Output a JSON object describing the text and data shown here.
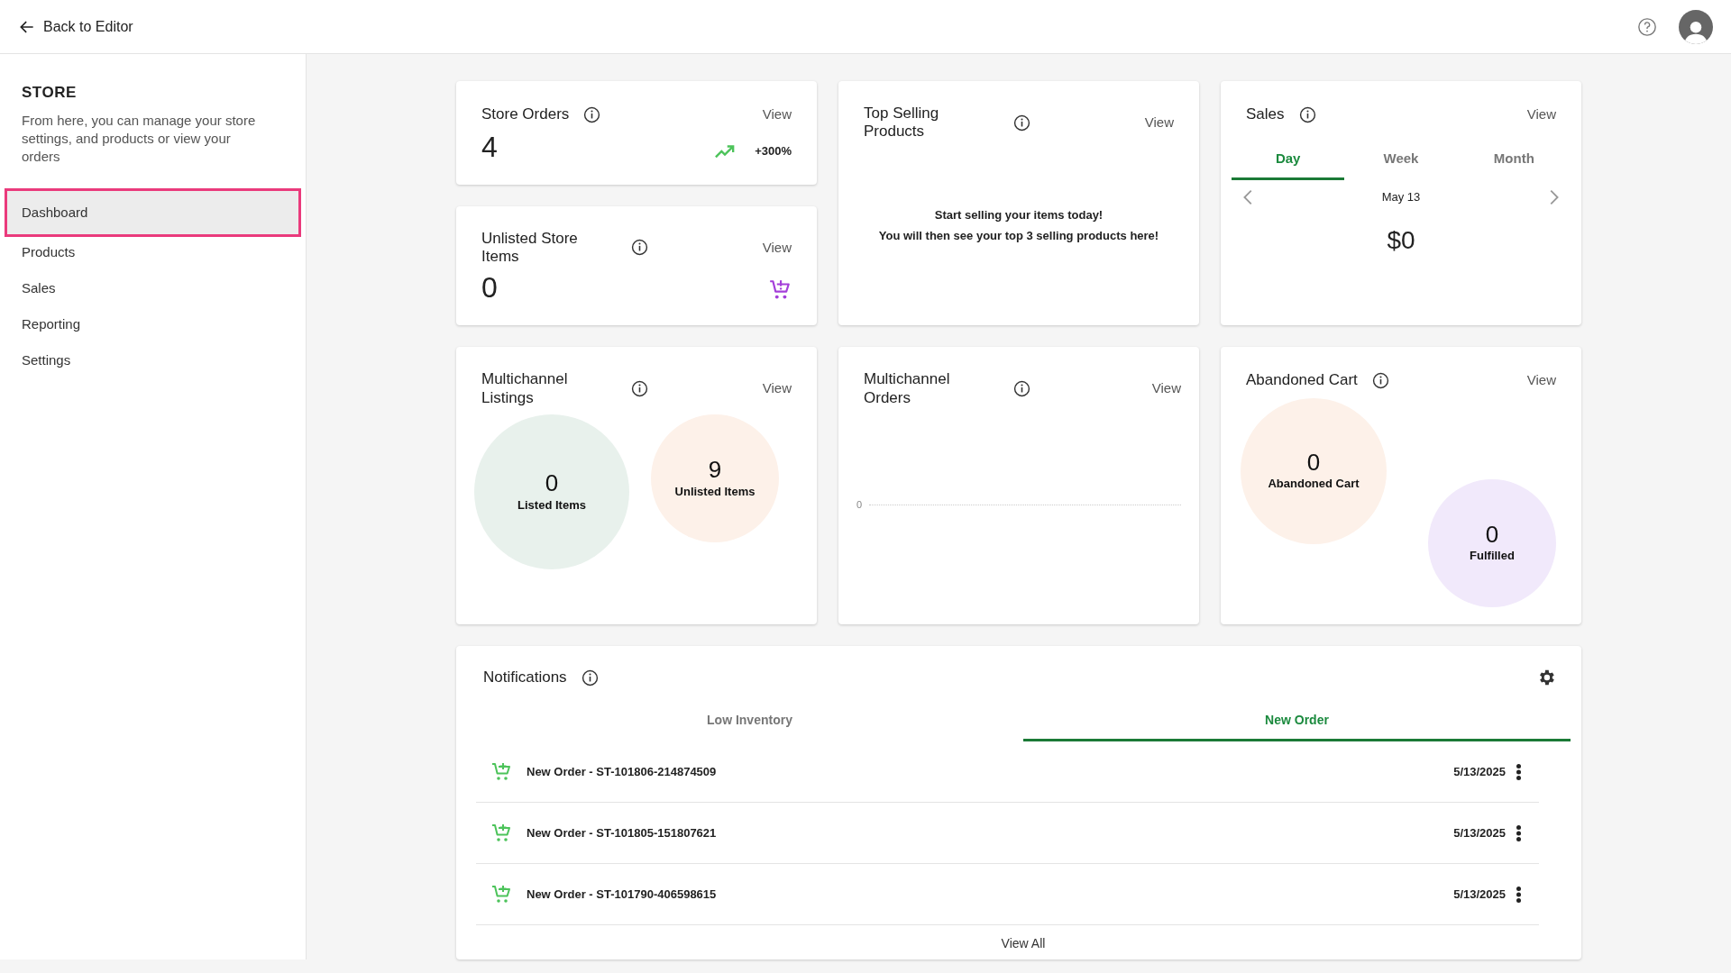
{
  "header": {
    "back_label": "Back to Editor"
  },
  "sidebar": {
    "title": "STORE",
    "description": "From here, you can manage your store settings, and products or view your orders",
    "items": [
      {
        "label": "Dashboard",
        "selected": true
      },
      {
        "label": "Products",
        "selected": false
      },
      {
        "label": "Sales",
        "selected": false
      },
      {
        "label": "Reporting",
        "selected": false
      },
      {
        "label": "Settings",
        "selected": false
      }
    ]
  },
  "store_orders": {
    "title": "Store Orders",
    "view": "View",
    "value": "4",
    "change": "+300%"
  },
  "unlisted_items": {
    "title": "Unlisted Store Items",
    "view": "View",
    "value": "0"
  },
  "top_selling": {
    "title": "Top Selling Products",
    "view": "View",
    "message_lines": [
      "Start selling your items today!",
      "You will then see your top 3 selling products here!"
    ]
  },
  "sales": {
    "title": "Sales",
    "view": "View",
    "tabs": [
      {
        "label": "Day",
        "selected": true
      },
      {
        "label": "Week",
        "selected": false
      },
      {
        "label": "Month",
        "selected": false
      }
    ],
    "date": "May 13",
    "amount": "$0"
  },
  "multichannel_listings": {
    "title": "Multichannel Listings",
    "view": "View",
    "bubbles": [
      {
        "value": "0",
        "label": "Listed Items",
        "color": "#e8f1ec"
      },
      {
        "value": "9",
        "label": "Unlisted Items",
        "color": "#fdf1e9"
      }
    ]
  },
  "multichannel_orders": {
    "title": "Multichannel Orders",
    "view": "View",
    "axis_label": "0"
  },
  "abandoned_cart": {
    "title": "Abandoned Cart",
    "view": "View",
    "bubbles": [
      {
        "value": "0",
        "label": "Abandoned Cart",
        "color": "#fdf1e9"
      },
      {
        "value": "0",
        "label": "Fulfilled",
        "color": "#f1e9fb"
      }
    ]
  },
  "notifications": {
    "title": "Notifications",
    "tabs": [
      {
        "label": "Low Inventory",
        "selected": false
      },
      {
        "label": "New Order",
        "selected": true
      }
    ],
    "items": [
      {
        "text": "New Order - ST-101806-214874509",
        "date": "5/13/2025"
      },
      {
        "text": "New Order - ST-101805-151807621",
        "date": "5/13/2025"
      },
      {
        "text": "New Order - ST-101790-406598615",
        "date": "5/13/2025"
      }
    ],
    "view_all": "View All"
  }
}
